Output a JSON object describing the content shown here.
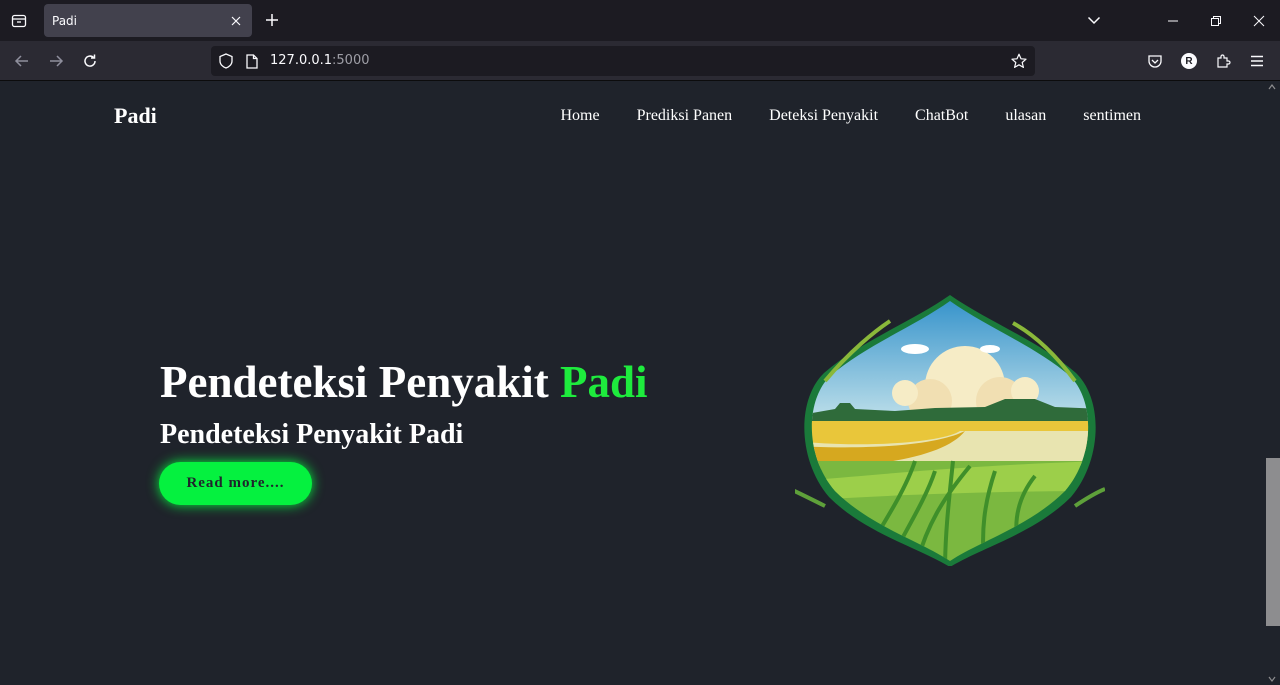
{
  "browser": {
    "tab_title": "Padi",
    "url_host": "127.0.0.1",
    "url_port": ":5000",
    "account_initial": "R"
  },
  "site": {
    "logo": "Padi",
    "nav": [
      "Home",
      "Prediksi Panen",
      "Deteksi Penyakit",
      "ChatBot",
      "ulasan",
      "sentimen"
    ]
  },
  "hero": {
    "title_main": "Pendeteksi Penyakit",
    "title_accent": "Padi",
    "subtitle": "Pendeteksi Penyakit Padi",
    "button_label": "Read more...."
  },
  "colors": {
    "accent": "#1eeb3d",
    "button": "#05f13f",
    "page_background": "#1f232b"
  },
  "icons": {
    "tab_list": "tab-list-icon",
    "new_tab": "plus-icon",
    "back": "arrow-left-icon",
    "forward": "arrow-right-icon",
    "reload": "reload-icon",
    "shield": "shield-icon",
    "page": "page-icon",
    "bookmark": "star-icon",
    "pocket": "pocket-icon",
    "extensions": "puzzle-icon",
    "menu": "hamburger-icon"
  }
}
